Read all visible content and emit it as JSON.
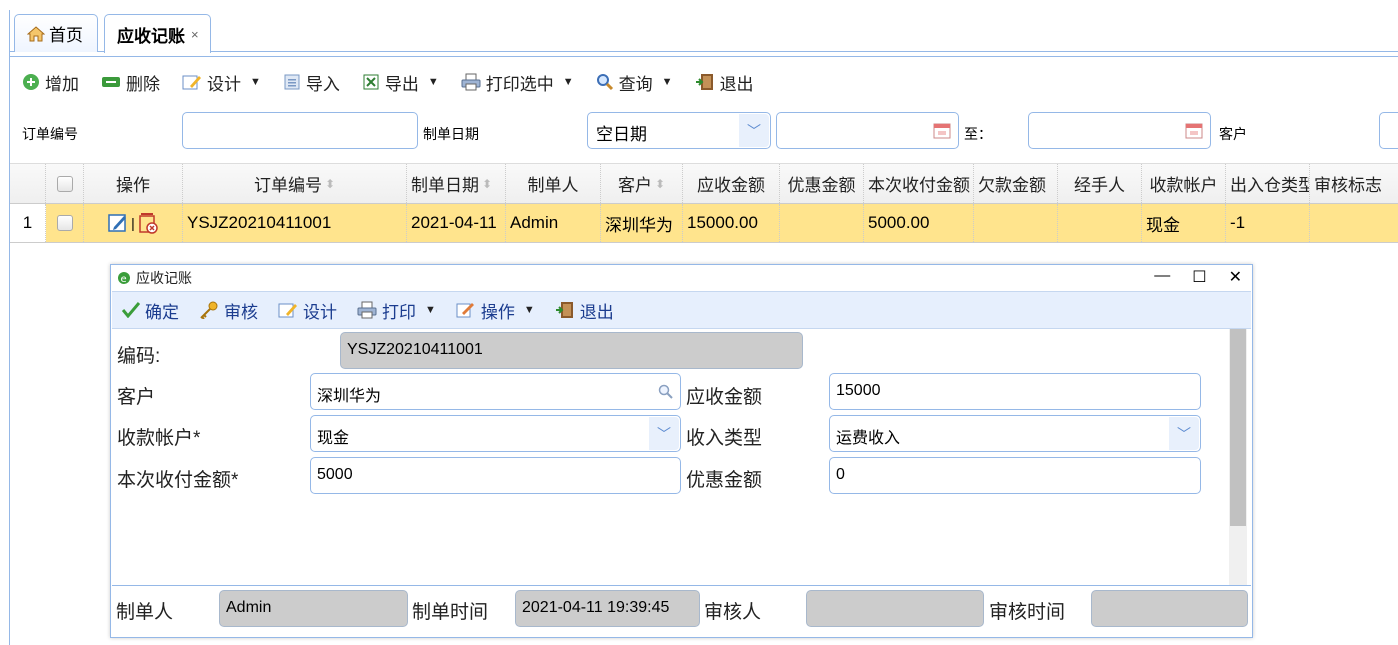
{
  "tabs": {
    "home": "首页",
    "active": "应收记账",
    "close": "×"
  },
  "toolbar": {
    "add": "增加",
    "delete": "删除",
    "design": "设计",
    "import": "导入",
    "export": "导出",
    "print_selected": "打印选中",
    "query": "查询",
    "exit": "退出"
  },
  "filter": {
    "order_no_label": "订单编号",
    "order_no_value": "",
    "date_label": "制单日期",
    "date_mode": "空日期",
    "date_from": "",
    "to_label": "至：",
    "date_to": "",
    "customer_label": "客户"
  },
  "grid": {
    "headers": [
      "操作",
      "订单编号",
      "制单日期",
      "制单人",
      "客户",
      "应收金额",
      "优惠金额",
      "本次收付金额",
      "欠款金额",
      "经手人",
      "收款帐户",
      "出入仓类型",
      "审核标志"
    ],
    "rows": [
      {
        "index": "1",
        "order_no": "YSJZ20210411001",
        "date": "2021-04-11",
        "creator": "Admin",
        "customer": "深圳华为",
        "receivable": "15000.00",
        "discount": "",
        "payment": "5000.00",
        "debt": "",
        "handler": "",
        "account": "现金",
        "type": "-1",
        "audit": ""
      }
    ]
  },
  "dialog": {
    "title": "应收记账",
    "tools": {
      "confirm": "确定",
      "audit": "审核",
      "design": "设计",
      "print": "打印",
      "operate": "操作",
      "exit": "退出"
    },
    "form": {
      "code_label": "编码:",
      "code_value": "YSJZ20210411001",
      "customer_label": "客户",
      "customer_value": "深圳华为",
      "receivable_label": "应收金额",
      "receivable_value": "15000",
      "account_label": "收款帐户*",
      "account_value": "现金",
      "income_type_label": "收入类型",
      "income_type_value": "运费收入",
      "payment_label": "本次收付金额*",
      "payment_value": "5000",
      "discount_label": "优惠金额",
      "discount_value": "0"
    },
    "footer": {
      "creator_label": "制单人",
      "creator_value": "Admin",
      "create_time_label": "制单时间",
      "create_time_value": "2021-04-11 19:39:45",
      "auditor_label": "审核人",
      "auditor_value": "",
      "audit_time_label": "审核时间",
      "audit_time_value": ""
    }
  },
  "colors": {
    "border": "#95b8e7",
    "row_selected": "#ffe48d",
    "dialog_toolbar": "#e6effd"
  }
}
